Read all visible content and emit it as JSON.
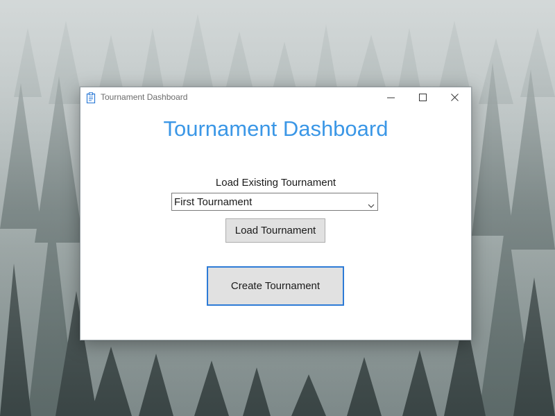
{
  "window": {
    "title": "Tournament Dashboard",
    "icon": "clipboard-icon",
    "controls": [
      "minimize-icon",
      "maximize-icon",
      "close-icon"
    ]
  },
  "main": {
    "heading": "Tournament Dashboard",
    "load_label": "Load Existing Tournament",
    "tournament_select": {
      "value": "First Tournament",
      "icon": "chevron-down-icon"
    },
    "load_button": "Load Tournament",
    "create_button": "Create Tournament"
  },
  "colors": {
    "heading": "#3b97e6",
    "focus_border": "#2c7ad6",
    "button_bg": "#e1e1e1",
    "window_bg": "#ffffff"
  }
}
